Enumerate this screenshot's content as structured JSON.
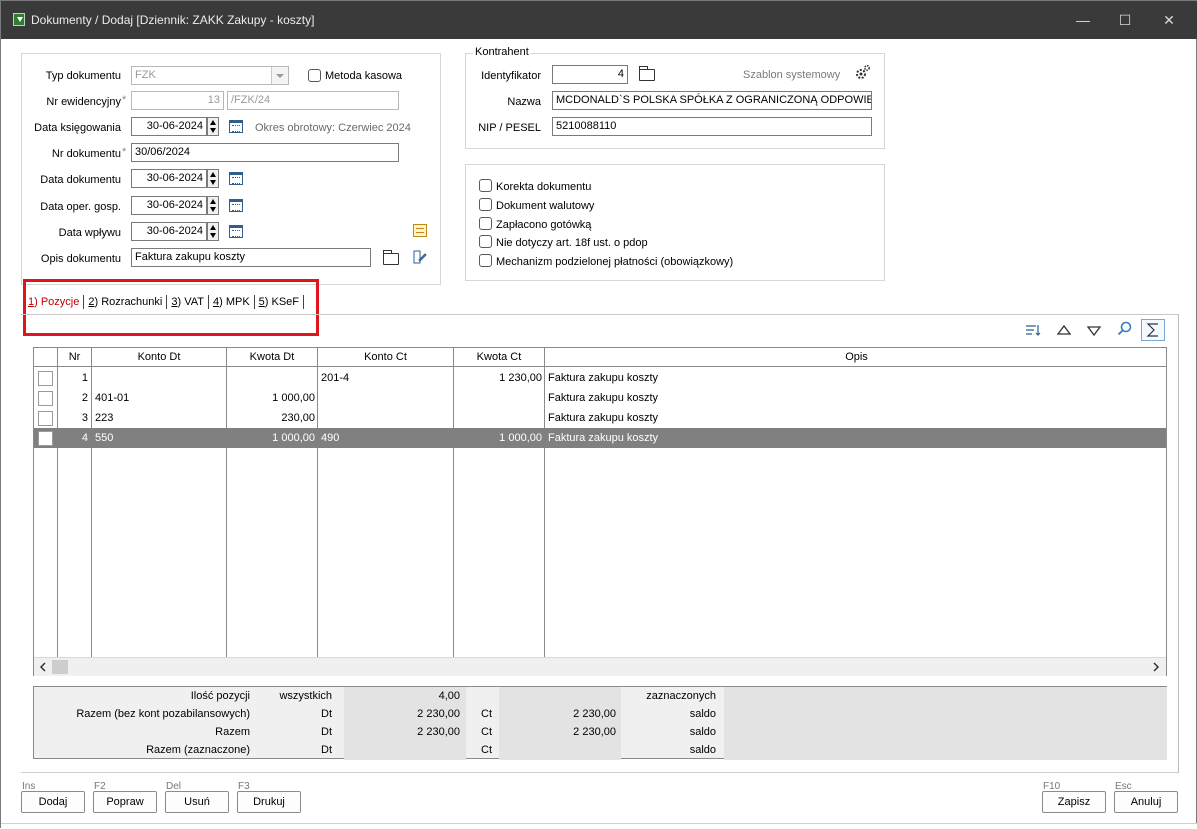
{
  "window": {
    "title": "Dokumenty / Dodaj [Dziennik: ZAKK  Zakupy - koszty]",
    "minimize": "—",
    "maximize": "☐",
    "close": "✕"
  },
  "form": {
    "typ_dokumentu_label": "Typ dokumentu",
    "typ_dokumentu_value": "FZK",
    "metoda_kasowa_label": "Metoda kasowa",
    "nr_ewidencyjny_label": "Nr ewidencyjny",
    "required_mark": "*",
    "nr_ewidencyjny_number": "13",
    "nr_ewidencyjny_suffix": "/FZK/24",
    "data_ksiegowania_label": "Data księgowania",
    "data_ksiegowania_value": "30-06-2024",
    "okres_obrotowy": "Okres obrotowy: Czerwiec 2024",
    "nr_dokumentu_label": "Nr dokumentu",
    "nr_dokumentu_value": "30/06/2024",
    "data_dokumentu_label": "Data dokumentu",
    "data_dokumentu_value": "30-06-2024",
    "data_oper_label": "Data oper. gosp.",
    "data_oper_value": "30-06-2024",
    "data_wplywu_label": "Data wpływu",
    "data_wplywu_value": "30-06-2024",
    "opis_label": "Opis dokumentu",
    "opis_value": "Faktura zakupu koszty"
  },
  "kontrahent": {
    "group_title": "Kontrahent",
    "identyfikator_label": "Identyfikator",
    "identyfikator_value": "4",
    "szablon": "Szablon systemowy",
    "nazwa_label": "Nazwa",
    "nazwa_value": "MCDONALD`S POLSKA SPÓŁKA Z OGRANICZONĄ ODPOWIE",
    "nip_label": "NIP / PESEL",
    "nip_value": "5210088110"
  },
  "options": [
    {
      "label": "Korekta dokumentu"
    },
    {
      "label": "Dokument walutowy"
    },
    {
      "label": "Zapłacono gotówką"
    },
    {
      "label": "Nie dotyczy art. 18f ust. o pdop"
    },
    {
      "label": "Mechanizm podzielonej płatności (obowiązkowy)"
    }
  ],
  "tabs": [
    {
      "key": "1",
      "label": ") Pozycje"
    },
    {
      "key": "2",
      "label": ") Rozrachunki"
    },
    {
      "key": "3",
      "label": ") VAT"
    },
    {
      "key": "4",
      "label": ") MPK"
    },
    {
      "key": "5",
      "label": ") KSeF"
    }
  ],
  "grid": {
    "columns": [
      "Nr",
      "Konto Dt",
      "Kwota Dt",
      "Konto Ct",
      "Kwota Ct",
      "Opis"
    ],
    "rows": [
      {
        "nr": "1",
        "konto_dt": "",
        "kwota_dt": "",
        "konto_ct": "201-4",
        "kwota_ct": "1 230,00",
        "opis": "Faktura zakupu koszty"
      },
      {
        "nr": "2",
        "konto_dt": "401-01",
        "kwota_dt": "1 000,00",
        "konto_ct": "",
        "kwota_ct": "",
        "opis": "Faktura zakupu koszty"
      },
      {
        "nr": "3",
        "konto_dt": "223",
        "kwota_dt": "230,00",
        "konto_ct": "",
        "kwota_ct": "",
        "opis": "Faktura zakupu koszty"
      },
      {
        "nr": "4",
        "konto_dt": "550",
        "kwota_dt": "1 000,00",
        "konto_ct": "490",
        "kwota_ct": "1 000,00",
        "opis": "Faktura zakupu koszty"
      }
    ],
    "selected_row": "4"
  },
  "summary": {
    "ilosc_label": "Ilość pozycji",
    "wszystkich": "wszystkich",
    "ilosc_value": "4,00",
    "zaznaczonych": "zaznaczonych",
    "razem_bez_label": "Razem (bez kont pozabilansowych)",
    "razem_label": "Razem",
    "razem_zazn_label": "Razem (zaznaczone)",
    "dt": "Dt",
    "ct": "Ct",
    "saldo": "saldo",
    "razem_bez_dt": "2 230,00",
    "razem_bez_ct": "2 230,00",
    "razem_dt": "2 230,00",
    "razem_ct": "2 230,00"
  },
  "buttons": {
    "dodaj": {
      "hint": "Ins",
      "label": "Dodaj"
    },
    "popraw": {
      "hint": "F2",
      "label": "Popraw"
    },
    "usun": {
      "hint": "Del",
      "label": "Usuń"
    },
    "drukuj": {
      "hint": "F3",
      "label": "Drukuj"
    },
    "zapisz": {
      "hint": "F10",
      "label": "Zapisz"
    },
    "anuluj": {
      "hint": "Esc",
      "label": "Anuluj"
    }
  }
}
